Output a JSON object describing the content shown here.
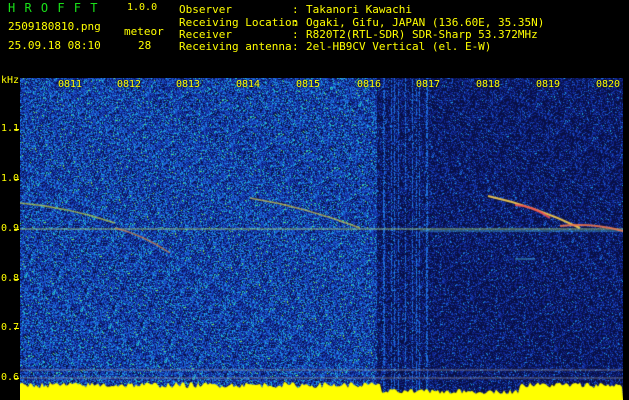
{
  "header": {
    "brand": "H R O F F T",
    "version": "1.0.0",
    "filename": "2509180810.png",
    "datetime": "25.09.18 08:10",
    "meteor_label": "meteor",
    "meteor_count": "28"
  },
  "info": [
    {
      "label": "Observer",
      "value": "Takanori Kawachi"
    },
    {
      "label": "Receiving Location",
      "value": "Ogaki, Gifu, JAPAN (136.60E, 35.35N)"
    },
    {
      "label": "Receiver",
      "value": "R820T2(RTL-SDR) SDR-Sharp 53.372MHz"
    },
    {
      "label": "Receiving antenna",
      "value": "2el-HB9CV Vertical (el. E-W)"
    }
  ],
  "info_separator": ":",
  "axis": {
    "unit": "kHz",
    "y_labels": [
      "1.1",
      "1.0",
      "0.9",
      "0.8",
      "0.7",
      "0.6"
    ],
    "y_range": [
      0.575,
      1.175
    ],
    "time_labels": [
      "0811",
      "0812",
      "0813",
      "0814",
      "0815",
      "0816",
      "0817",
      "0818",
      "0819",
      "0820"
    ]
  },
  "colors": {
    "text": "#ffff00",
    "background": "#000000",
    "noise_bright": "#1a3aa8",
    "noise_dark": "#101a60",
    "signal": "#d0e840",
    "baseline_fill": "#ffff00"
  }
}
